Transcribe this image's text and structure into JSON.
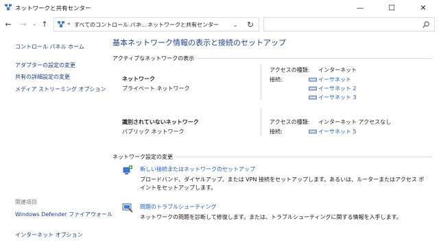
{
  "window": {
    "title": "ネットワークと共有センター",
    "minimize_glyph": "—",
    "maximize_glyph": "☐",
    "close_glyph": "✕"
  },
  "nav": {
    "back_glyph": "←",
    "forward_glyph": "→",
    "recent_glyph": "⌄",
    "up_glyph": "↑",
    "address_separator": "«",
    "breadcrumb": [
      "すべてのコントロール パネ...",
      "ネットワークと共有センター"
    ],
    "breadcrumb_separator": "›",
    "dropdown_glyph": "⌄",
    "refresh_glyph": "↻",
    "search_placeholder": ""
  },
  "sidebar": {
    "home": "コントロール パネル ホーム",
    "links": [
      "アダプターの設定の変更",
      "共有の詳細設定の変更",
      "メディア ストリーミング オプション"
    ],
    "related_heading": "関連項目",
    "related_links": [
      "Windows Defender ファイアウォール",
      "インターネット オプション"
    ]
  },
  "main": {
    "title": "基本ネットワーク情報の表示と接続のセットアップ",
    "active_networks_label": "アクティブなネットワークの表示",
    "networks": [
      {
        "name": "ネットワーク",
        "type": "プライベート ネットワーク",
        "access_label": "アクセスの種類:",
        "access_value": "インターネット",
        "connections_label": "接続:",
        "connections": [
          "イーサネット",
          "イーサネット 2",
          "イーサネット 3"
        ]
      },
      {
        "name": "識別されていないネットワーク",
        "type": "パブリック ネットワーク",
        "access_label": "アクセスの種類:",
        "access_value": "インターネット アクセスなし",
        "connections_label": "接続:",
        "connections": [
          "イーサネット 5"
        ]
      }
    ],
    "settings_label": "ネットワーク設定の変更",
    "tasks": [
      {
        "link": "新しい接続またはネットワークのセットアップ",
        "desc": "ブロードバンド、ダイヤルアップ、または VPN 接続をセットアップします。あるいは、ルーターまたはアクセス ポイントをセットアップします。"
      },
      {
        "link": "問題のトラブルシューティング",
        "desc": "ネットワークの問題を診断して修復します。または、トラブルシューティングに関する情報を入手します。"
      }
    ]
  },
  "colors": {
    "link": "#1e5ab8",
    "title": "#1c3f8c",
    "sidebar_link": "#1a3a7a"
  }
}
